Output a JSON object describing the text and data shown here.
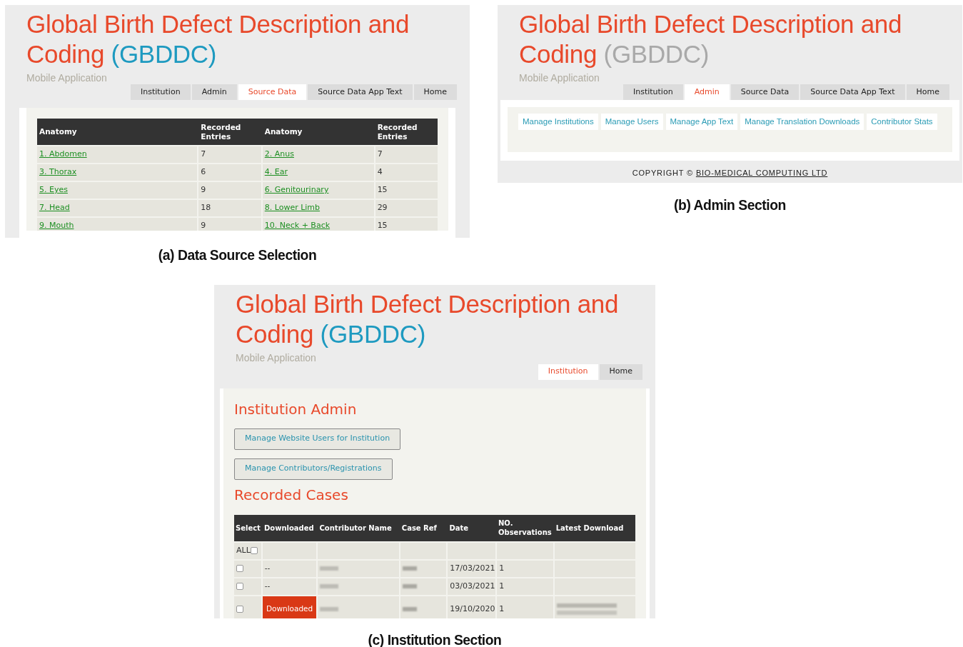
{
  "panels": [
    {
      "kind": "source_data",
      "caption": "(a) Data Source Selection",
      "title": "Global Birth Defect Description and Coding",
      "acronym": "(GBDDC)",
      "acronym_faded": false,
      "subtitle": "Mobile Application",
      "tabs": [
        {
          "label": "Institution",
          "selected": false
        },
        {
          "label": "Admin",
          "selected": false
        },
        {
          "label": "Source Data",
          "selected": true
        },
        {
          "label": "Source Data App Text",
          "selected": false
        },
        {
          "label": "Home",
          "selected": false
        }
      ],
      "table": {
        "columns": [
          "Anatomy",
          "Recorded Entries",
          "Anatomy",
          "Recorded Entries"
        ],
        "rows": [
          [
            "1. Abdomen",
            "7",
            "2. Anus",
            "7"
          ],
          [
            "3. Thorax",
            "6",
            "4. Ear",
            "4"
          ],
          [
            "5. Eyes",
            "9",
            "6. Genitourinary",
            "15"
          ],
          [
            "7. Head",
            "18",
            "8. Lower Limb",
            "29"
          ],
          [
            "9. Mouth",
            "9",
            "10. Neck + Back",
            "15"
          ]
        ]
      }
    },
    {
      "kind": "admin",
      "caption": "(b) Admin Section",
      "title": "Global Birth Defect Description and Coding",
      "acronym": "(GBDDC)",
      "acronym_faded": true,
      "subtitle": "Mobile Application",
      "tabs": [
        {
          "label": "Institution",
          "selected": false
        },
        {
          "label": "Admin",
          "selected": true
        },
        {
          "label": "Source Data",
          "selected": false
        },
        {
          "label": "Source Data App Text",
          "selected": false
        },
        {
          "label": "Home",
          "selected": false
        }
      ],
      "links": [
        "Manage Institutions",
        "Manage Users",
        "Manage App Text",
        "Manage Translation Downloads",
        "Contributor Stats"
      ],
      "copyright": {
        "text": "COPYRIGHT ©",
        "link": "BIO-MEDICAL COMPUTING LTD"
      }
    },
    {
      "kind": "institution",
      "caption": "(c) Institution Section",
      "title": "Global Birth Defect Description and Coding",
      "acronym": "(GBDDC)",
      "acronym_faded": false,
      "subtitle": "Mobile Application",
      "tabs": [
        {
          "label": "Institution",
          "selected": true
        },
        {
          "label": "Home",
          "selected": false
        }
      ],
      "heading": "Institution Admin",
      "buttons": [
        "Manage Website Users for Institution",
        "Manage Contributors/Registrations"
      ],
      "cases_heading": "Recorded Cases",
      "table": {
        "columns": [
          "Select",
          "Downloaded",
          "Contributor Name",
          "Case Ref",
          "Date",
          "NO. Observations",
          "Latest Download"
        ],
        "all_label": "ALL",
        "all_checked": false,
        "rows": [
          {
            "checked": false,
            "downloaded": false,
            "downloaded_text": "--",
            "date": "17/03/2021",
            "observations": "1",
            "has_latest": false
          },
          {
            "checked": false,
            "downloaded": false,
            "downloaded_text": "--",
            "date": "03/03/2021",
            "observations": "1",
            "has_latest": false
          },
          {
            "checked": false,
            "downloaded": true,
            "downloaded_text": "Downloaded",
            "date": "19/10/2020",
            "observations": "1",
            "has_latest": true
          }
        ]
      }
    }
  ]
}
